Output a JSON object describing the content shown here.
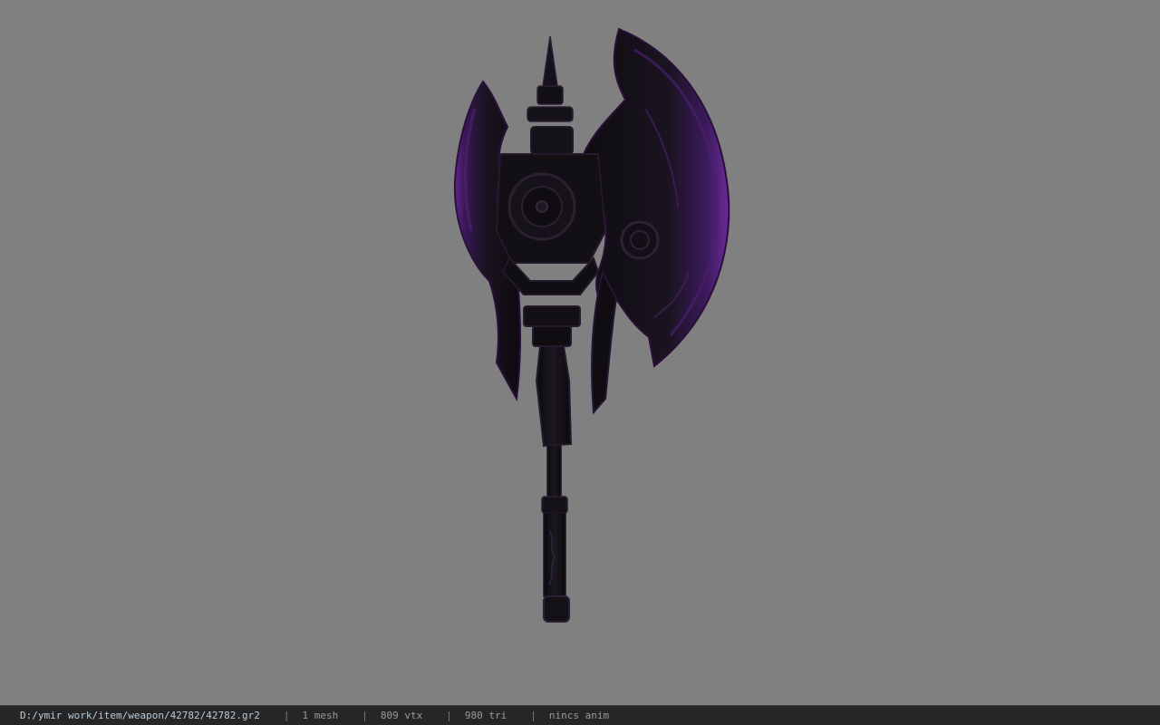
{
  "viewport": {
    "background_color": "#808080",
    "model": {
      "description_icon": "battle-axe-model",
      "accent_color": "#6a2a9a",
      "body_color": "#111014"
    }
  },
  "statusbar": {
    "file_path": "D:/ymir work/item/weapon/42782/42782.gr2",
    "separator": "|",
    "mesh_count": "1 mesh",
    "vertex_count": "809 vtx",
    "triangle_count": "980 tri",
    "animation": "nincs anim"
  }
}
